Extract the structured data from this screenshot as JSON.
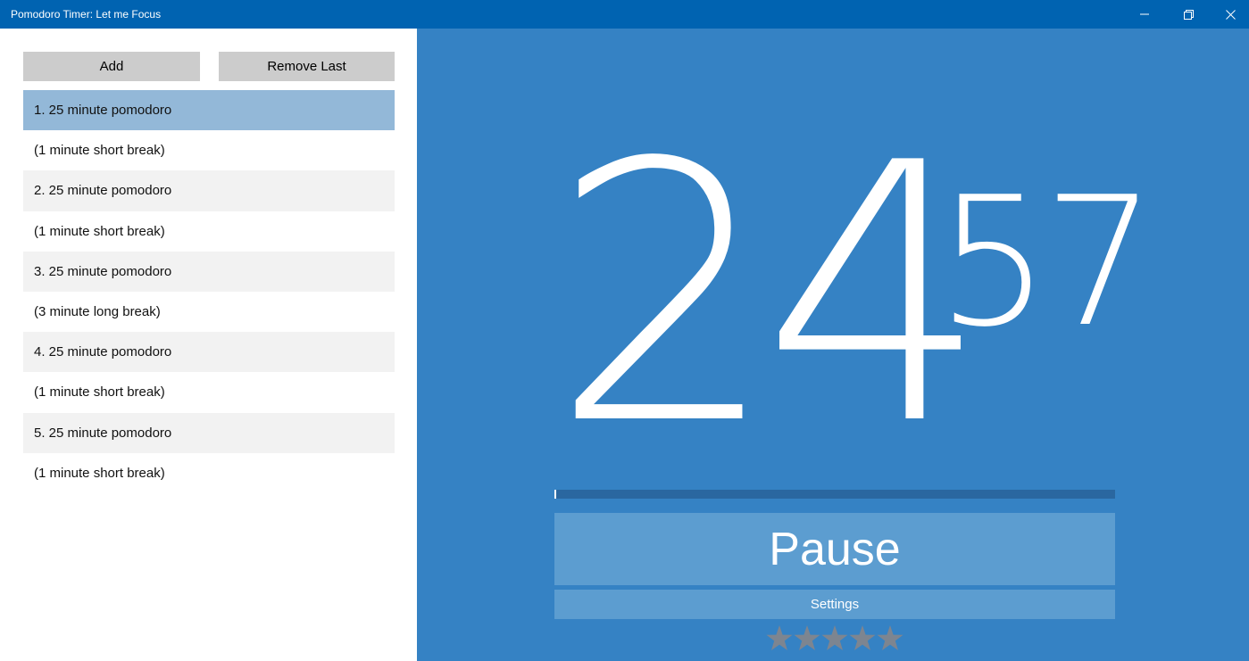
{
  "window": {
    "title": "Pomodoro Timer: Let me Focus"
  },
  "toolbar": {
    "add_label": "Add",
    "remove_last_label": "Remove Last"
  },
  "queue": {
    "items": [
      {
        "label": "1. 25 minute pomodoro",
        "selected": true
      },
      {
        "label": "(1 minute short break)"
      },
      {
        "label": "2. 25 minute pomodoro"
      },
      {
        "label": "(1 minute short break)"
      },
      {
        "label": "3. 25 minute pomodoro"
      },
      {
        "label": "(3 minute long break)"
      },
      {
        "label": "4. 25 minute pomodoro"
      },
      {
        "label": "(1 minute short break)"
      },
      {
        "label": "5. 25 minute pomodoro"
      },
      {
        "label": "(1 minute short break)"
      }
    ]
  },
  "timer": {
    "minutes": "24",
    "seconds": "57",
    "progress": 0.002
  },
  "controls": {
    "pause_label": "Pause",
    "settings_label": "Settings"
  },
  "rating": {
    "stars": 5,
    "filled": 0
  },
  "colors": {
    "titlebar": "#0063b1",
    "timer_background": "#3582c4",
    "button_background": "#5c9dd0",
    "progress_track": "#2a67a0",
    "selected_item": "#93b8d8",
    "alt_item": "#f2f2f2",
    "star_gray": "#7d8590"
  },
  "icons": {
    "minimize": "minimize-icon",
    "restore": "restore-icon",
    "close": "close-icon",
    "star": "star-icon"
  }
}
